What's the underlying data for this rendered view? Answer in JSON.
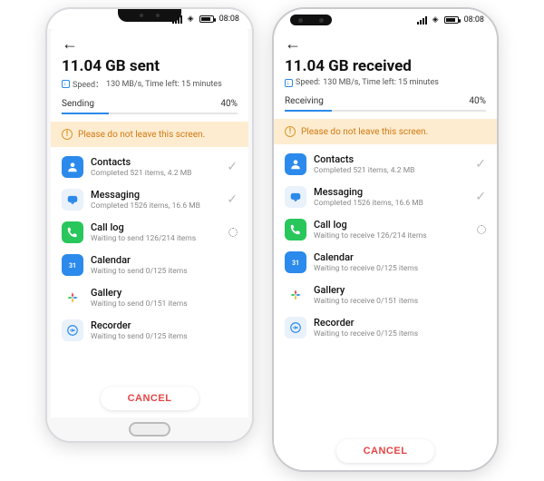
{
  "statusbar": {
    "time": "08:08"
  },
  "left": {
    "title": "11.04 GB sent",
    "speed_label": "Speed：",
    "speed_value": "130 MB/s, Time left: 15 minutes",
    "tab": "Sending",
    "progress": "40%",
    "warning": "Please do not leave this screen.",
    "cancel": "CANCEL",
    "items": [
      {
        "title": "Contacts",
        "sub": "Completed 521 items, 4.2 MB",
        "status": "done"
      },
      {
        "title": "Messaging",
        "sub": "Completed 1526 items, 16.6 MB",
        "status": "done"
      },
      {
        "title": "Call log",
        "sub": "Waiting to send 126/214 items",
        "status": "busy"
      },
      {
        "title": "Calendar",
        "sub": "Waiting to send  0/125 items",
        "status": "idle"
      },
      {
        "title": "Gallery",
        "sub": "Waiting to send  0/151 items",
        "status": "idle"
      },
      {
        "title": "Recorder",
        "sub": "Waiting to send  0/125 items",
        "status": "idle"
      }
    ]
  },
  "right": {
    "title": "11.04 GB received",
    "speed_label": "Speed:",
    "speed_value": "130 MB/s, Time left: 15 minutes",
    "tab": "Receiving",
    "progress": "40%",
    "warning": "Please do not leave this screen.",
    "cancel": "CANCEL",
    "items": [
      {
        "title": "Contacts",
        "sub": "Completed 521 items, 4.2 MB",
        "status": "done"
      },
      {
        "title": "Messaging",
        "sub": "Completed 1526 items, 16.6 MB",
        "status": "done"
      },
      {
        "title": "Call log",
        "sub": "Waiting to receive 126/214 items",
        "status": "busy"
      },
      {
        "title": "Calendar",
        "sub": "Waiting to receive  0/125 items",
        "status": "idle"
      },
      {
        "title": "Gallery",
        "sub": "Waiting to receive  0/151 items",
        "status": "idle"
      },
      {
        "title": "Recorder",
        "sub": "Waiting to receive  0/125 items",
        "status": "idle"
      }
    ]
  },
  "icons": [
    "contacts",
    "messaging",
    "call",
    "calendar",
    "gallery",
    "recorder"
  ]
}
